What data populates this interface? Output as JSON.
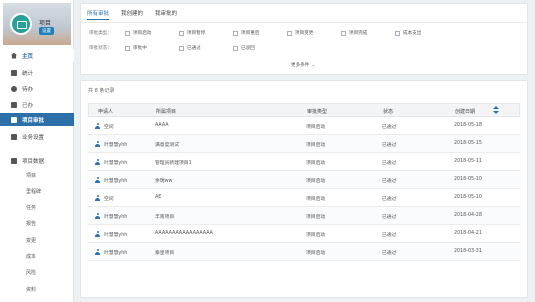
{
  "profile": {
    "name": "项目",
    "badge": "设置"
  },
  "sidebar": {
    "main": [
      {
        "label": "主页"
      },
      {
        "label": "统计"
      },
      {
        "label": "待办"
      },
      {
        "label": "已办"
      },
      {
        "label": "项目审批"
      },
      {
        "label": "业务设置"
      }
    ],
    "section": "项目数据",
    "sub": [
      "项目",
      "里程碑",
      "任务",
      "报告",
      "变更",
      "成本",
      "风险",
      "资料"
    ]
  },
  "tabs": [
    "所有审批",
    "我创建的",
    "我审批的"
  ],
  "filters": {
    "type_label": "审批类型：",
    "types": [
      "项目启动",
      "项目暂停",
      "项目重启",
      "项目变更",
      "项目完成",
      "成本支出"
    ],
    "status_label": "审批状态：",
    "statuses": [
      "审批中",
      "已通过",
      "已驳回"
    ],
    "more": "更多条件",
    "more_arrow": "⌄"
  },
  "table": {
    "records": "共 8 条记录",
    "headers": [
      "申请人",
      "所属项目",
      "审批类型",
      "状态",
      "创建日期"
    ],
    "rows": [
      {
        "applicant": "空间",
        "project": "AAAA",
        "type": "项目启动",
        "status": "已通过",
        "date": "2018-05-18"
      },
      {
        "applicant": "叶慧慧yhh",
        "project": "满意度测试",
        "type": "项目启动",
        "status": "已通过",
        "date": "2018-05-15"
      },
      {
        "applicant": "叶慧慧yhh",
        "project": "管理员新建项目1",
        "type": "项目启动",
        "status": "已通过",
        "date": "2018-05-11"
      },
      {
        "applicant": "叶慧慧yhh",
        "project": "余瑞ww",
        "type": "项目启动",
        "status": "已通过",
        "date": "2018-05-10"
      },
      {
        "applicant": "空间",
        "project": "AE",
        "type": "项目启动",
        "status": "已通过",
        "date": "2018-05-10"
      },
      {
        "applicant": "叶慧慧yhh",
        "project": "丰南项目",
        "type": "项目启动",
        "status": "已通过",
        "date": "2018-04-28"
      },
      {
        "applicant": "叶慧慧yhh",
        "project": "AAAAAAAAAAAAAAAAA",
        "type": "项目启动",
        "status": "已通过",
        "date": "2018-04-21"
      },
      {
        "applicant": "叶慧慧yhh",
        "project": "秦皇项目",
        "type": "项目启动",
        "status": "已通过",
        "date": "2018-03-31"
      }
    ]
  },
  "colors": {
    "accent": "#2d6fa8",
    "sidebar_active": "#2d6fa8",
    "avatar": "#2aa198"
  }
}
